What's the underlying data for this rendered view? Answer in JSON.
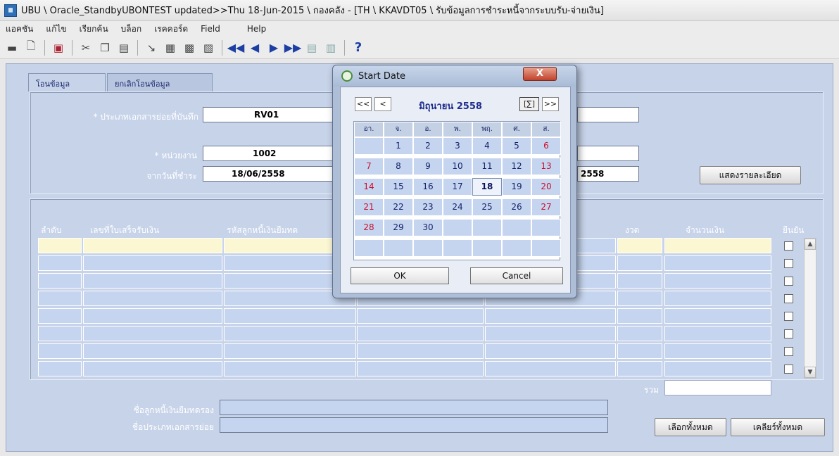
{
  "window": {
    "title": "UBU \\ Oracle_StandbyUBONTEST updated>>Thu 18-Jun-2015 \\ กองคลัง - [TH \\ KKAVDT05 \\ รับข้อมูลการชำระหนี้จากระบบรับ-จ่ายเงิน]",
    "icon": "oracle-forms-icon"
  },
  "menu": [
    "แอคชัน",
    "แก้ไข",
    "เรียกค้น",
    "บล็อก",
    "เรคคอร์ด",
    "Field",
    "Help"
  ],
  "toolbar": {
    "icons": [
      "save-icon",
      "print-preview-icon",
      "exit-icon",
      "cut-icon",
      "copy-icon",
      "paste-icon",
      "clear-field-icon",
      "insert-record-icon",
      "duplicate-record-icon",
      "delete-record-icon",
      "first-record-icon",
      "previous-record-icon",
      "next-record-icon",
      "last-record-icon",
      "list-icon",
      "edit-icon",
      "help-icon"
    ],
    "help_glyph": "?"
  },
  "tabs": [
    {
      "label": "โอนข้อมูล",
      "active": true
    },
    {
      "label": "ยกเลิกโอนข้อมูล",
      "active": false
    }
  ],
  "form": {
    "doc_type_label": "* ประเภทเอกสารย่อยที่บันทึก",
    "doc_type_value": "RV01",
    "unit_label": "* หน่วยงาน",
    "unit_value": "1002",
    "from_date_label": "จากวันที่ชำระ",
    "from_date_value": "18/06/2558",
    "to_date_value_fragment": "2558",
    "show_detail_button": "แสดงรายละเอียด"
  },
  "grid": {
    "headers": [
      "ลำดับ",
      "เลขที่ใบเสร็จรับเงิน",
      "รหัสลูกหนี้เงินยืมทด",
      "งวด",
      "จำนวนเงิน",
      "ยืนยัน"
    ],
    "row_count": 8,
    "total_label": "รวม",
    "total_value": ""
  },
  "footer": {
    "debtor_name_label": "ชื่อลูกหนี้เงินยืมทดรอง",
    "debtor_name_value": "",
    "doc_type_name_label": "ชื่อประเภทเอกสารย่อย",
    "doc_type_name_value": "",
    "select_all_button": "เลือกทั้งหมด",
    "clear_all_button": "เคลียร์ทั้งหมด"
  },
  "dialog": {
    "title": "Start Date",
    "close_glyph": "X",
    "nav": {
      "prev_year": "<<",
      "prev_month": "<",
      "today": "[∑]",
      "next_month": ">>"
    },
    "month_label": "มิถุนายน 2558",
    "weekdays": [
      "อา.",
      "จ.",
      "อ.",
      "พ.",
      "พฤ.",
      "ศ.",
      "ส."
    ],
    "weeks": [
      [
        "",
        "1",
        "2",
        "3",
        "4",
        "5",
        "6"
      ],
      [
        "7",
        "8",
        "9",
        "10",
        "11",
        "12",
        "13"
      ],
      [
        "14",
        "15",
        "16",
        "17",
        "18",
        "19",
        "20"
      ],
      [
        "21",
        "22",
        "23",
        "24",
        "25",
        "26",
        "27"
      ],
      [
        "28",
        "29",
        "30",
        "",
        "",
        "",
        ""
      ],
      [
        "",
        "",
        "",
        "",
        "",
        "",
        ""
      ]
    ],
    "selected_day": "18",
    "weekend_color": "#c8102e",
    "ok_label": "OK",
    "cancel_label": "Cancel"
  }
}
